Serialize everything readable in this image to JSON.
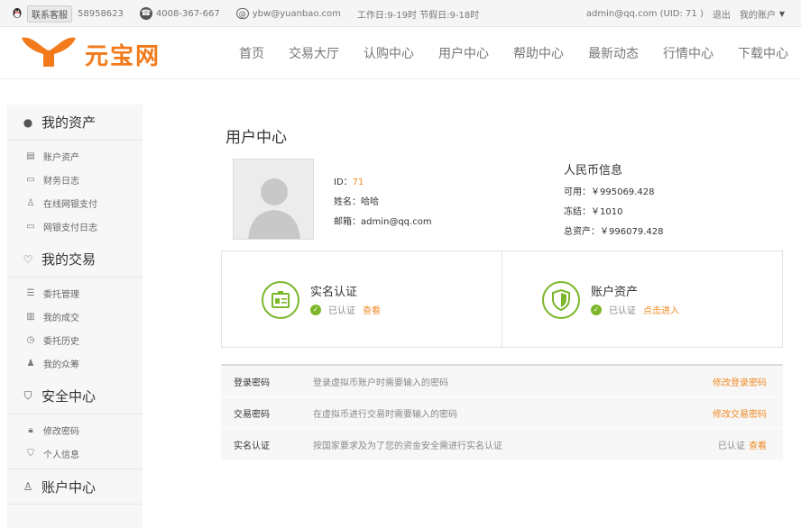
{
  "topbar": {
    "service_label": "联系客服",
    "qq_number": "58958623",
    "phone": "4008-367-667",
    "email": "ybw@yuanbao.com",
    "work_hours": "工作日:9-19时 节假日:9-18时",
    "user_info": "admin@qq.com (UID: 71 )",
    "logout": "退出",
    "my_account": "我的账户"
  },
  "header": {
    "logo_text": "元宝网",
    "nav": [
      "首页",
      "交易大厅",
      "认购中心",
      "用户中心",
      "帮助中心",
      "最新动态",
      "行情中心",
      "下载中心"
    ]
  },
  "sidebar": {
    "groups": [
      {
        "title": "我的资产",
        "icon": "moneybag-icon",
        "items": [
          "账户资产",
          "财务日志",
          "在线网银支付",
          "网银支付日志"
        ]
      },
      {
        "title": "我的交易",
        "icon": "heart-icon",
        "items": [
          "委托管理",
          "我的成交",
          "委托历史",
          "我的众筹"
        ]
      },
      {
        "title": "安全中心",
        "icon": "shield-icon",
        "items": [
          "修改密码",
          "个人信息"
        ]
      },
      {
        "title": "账户中心",
        "icon": "user-icon",
        "items": []
      }
    ]
  },
  "main": {
    "title": "用户中心",
    "user": {
      "id_label": "ID：",
      "id_value": "71",
      "name_label": "姓名：",
      "name_value": "哈哈",
      "email_label": "邮箱：",
      "email_value": "admin@qq.com"
    },
    "rmb": {
      "title": "人民币信息",
      "available": "可用：￥995069.428",
      "frozen": "冻结：￥1010",
      "total": "总资产：￥996079.428"
    },
    "cards": [
      {
        "title": "实名认证",
        "status": "已认证",
        "link": "查看"
      },
      {
        "title": "账户资产",
        "status": "已认证",
        "link": "点击进入"
      }
    ],
    "security_rows": [
      {
        "name": "登录密码",
        "desc": "登录虚拟币账户时需要输入的密码",
        "status": "",
        "action": "修改登录密码"
      },
      {
        "name": "交易密码",
        "desc": "在虚拟币进行交易时需要输入的密码",
        "status": "",
        "action": "修改交易密码"
      },
      {
        "name": "实名认证",
        "desc": "按国家要求及为了您的资金安全需进行实名认证",
        "status": "已认证",
        "action": "查看"
      }
    ]
  },
  "colors": {
    "accent": "#f27a1a",
    "link": "#f08a24",
    "green": "#7cb72a"
  }
}
